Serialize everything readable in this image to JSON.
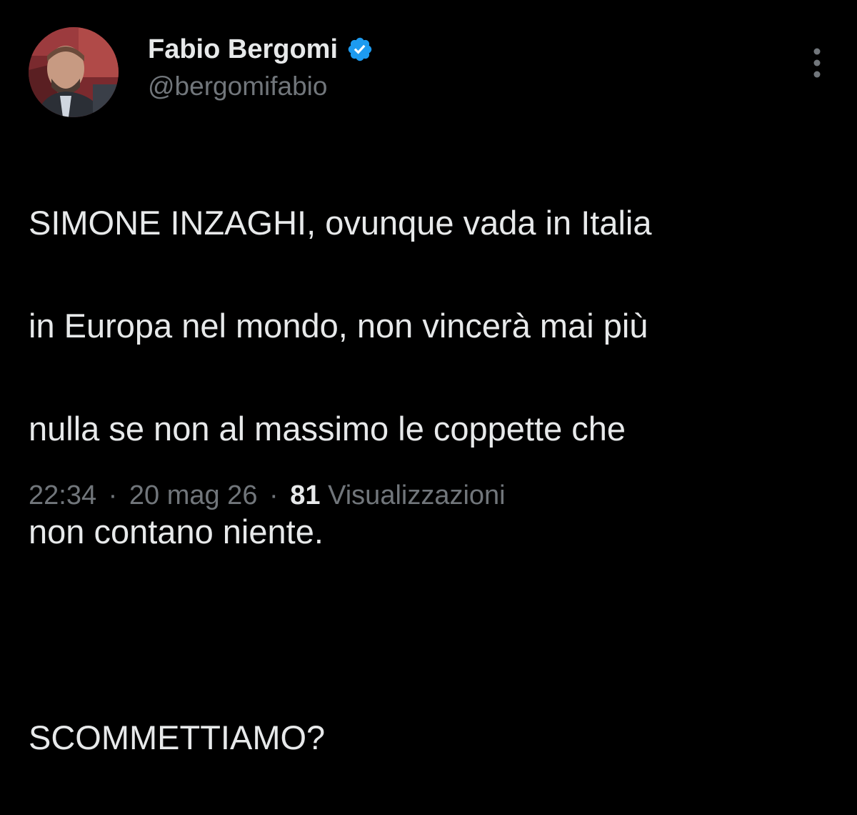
{
  "author": {
    "display_name": "Fabio Bergomi",
    "handle": "@bergomifabio",
    "verified_icon": "verified-badge-icon",
    "verified_color": "#1d9bf0"
  },
  "tweet": {
    "lines": [
      "SIMONE INZAGHI, ovunque vada in Italia",
      "in Europa nel mondo, non vincerà mai più",
      "nulla se non al massimo le coppette che",
      "non contano niente."
    ],
    "closing": "SCOMMETTIAMO?"
  },
  "meta": {
    "time": "22:34",
    "separator": "·",
    "date": "20 mag 26",
    "views_count": "81",
    "views_label": "Visualizzazioni"
  },
  "menu": {
    "icon": "more-vertical-icon"
  },
  "colors": {
    "background": "#000000",
    "text": "#e7e9ea",
    "secondary": "#71767b"
  }
}
